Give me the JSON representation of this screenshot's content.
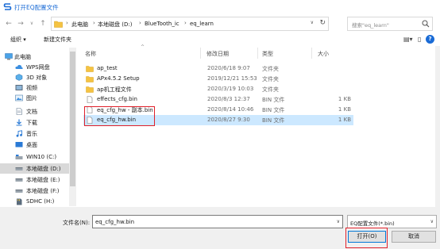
{
  "window": {
    "title": "打开EQ配置文件"
  },
  "address": {
    "crumbs": [
      "此电脑",
      "本地磁盘 (D:)",
      "BlueTooth_ic",
      "eq_learn"
    ],
    "separator": "›"
  },
  "search": {
    "placeholder": "搜索\"eq_learn\""
  },
  "toolbar": {
    "organize_label": "组织 ▾",
    "new_folder_label": "新建文件夹"
  },
  "sidebar": {
    "items": [
      {
        "label": "此电脑",
        "icon": "computer-icon"
      },
      {
        "label": "WPS网盘",
        "icon": "cloud-icon"
      },
      {
        "label": "3D 对象",
        "icon": "cube-icon"
      },
      {
        "label": "视频",
        "icon": "video-icon"
      },
      {
        "label": "图片",
        "icon": "picture-icon"
      },
      {
        "label": "文档",
        "icon": "document-icon"
      },
      {
        "label": "下载",
        "icon": "download-icon"
      },
      {
        "label": "音乐",
        "icon": "music-icon"
      },
      {
        "label": "桌面",
        "icon": "desktop-icon"
      },
      {
        "label": "WIN10 (C:)",
        "icon": "drive-icon"
      },
      {
        "label": "本地磁盘 (D:)",
        "icon": "drive-icon"
      },
      {
        "label": "本地磁盘 (E:)",
        "icon": "drive-icon"
      },
      {
        "label": "本地磁盘 (F:)",
        "icon": "drive-icon"
      },
      {
        "label": "SDHC (H:)",
        "icon": "sd-card-icon"
      }
    ]
  },
  "columns": {
    "name": "名称",
    "date": "修改日期",
    "type": "类型",
    "size": "大小"
  },
  "files": [
    {
      "name": "ap_test",
      "date": "2020/6/18 9:07",
      "type": "文件夹",
      "size": "",
      "kind": "folder"
    },
    {
      "name": "APx4.5.2 Setup",
      "date": "2019/12/21 15:53",
      "type": "文件夹",
      "size": "",
      "kind": "folder"
    },
    {
      "name": "ap机工程文件",
      "date": "2020/3/19 10:03",
      "type": "文件夹",
      "size": "",
      "kind": "folder"
    },
    {
      "name": "effects_cfg.bin",
      "date": "2020/8/3 12:37",
      "type": "BIN 文件",
      "size": "1 KB",
      "kind": "file"
    },
    {
      "name": "eq_cfg_hw - 副本.bin",
      "date": "2020/8/14 10:46",
      "type": "BIN 文件",
      "size": "1 KB",
      "kind": "file"
    },
    {
      "name": "eq_cfg_hw.bin",
      "date": "2020/8/27 9:30",
      "type": "BIN 文件",
      "size": "1 KB",
      "kind": "file"
    }
  ],
  "footer": {
    "filename_label": "文件名(N):",
    "filename_value": "eq_cfg_hw.bin",
    "filter_value": "EQ配置文件(*.bin)",
    "open_label": "打开(O)",
    "cancel_label": "取消"
  },
  "colors": {
    "accent": "#1a6bd6",
    "selection": "#cce8ff",
    "highlight": "#e0202a",
    "folder": "#f5c342"
  }
}
